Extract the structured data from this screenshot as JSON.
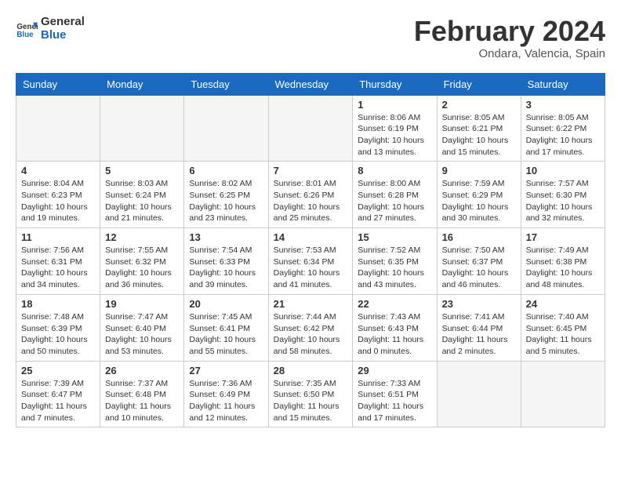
{
  "header": {
    "logo_line1": "General",
    "logo_line2": "Blue",
    "month_title": "February 2024",
    "subtitle": "Ondara, Valencia, Spain"
  },
  "weekdays": [
    "Sunday",
    "Monday",
    "Tuesday",
    "Wednesday",
    "Thursday",
    "Friday",
    "Saturday"
  ],
  "weeks": [
    [
      {
        "day": "",
        "info": ""
      },
      {
        "day": "",
        "info": ""
      },
      {
        "day": "",
        "info": ""
      },
      {
        "day": "",
        "info": ""
      },
      {
        "day": "1",
        "info": "Sunrise: 8:06 AM\nSunset: 6:19 PM\nDaylight: 10 hours\nand 13 minutes."
      },
      {
        "day": "2",
        "info": "Sunrise: 8:05 AM\nSunset: 6:21 PM\nDaylight: 10 hours\nand 15 minutes."
      },
      {
        "day": "3",
        "info": "Sunrise: 8:05 AM\nSunset: 6:22 PM\nDaylight: 10 hours\nand 17 minutes."
      }
    ],
    [
      {
        "day": "4",
        "info": "Sunrise: 8:04 AM\nSunset: 6:23 PM\nDaylight: 10 hours\nand 19 minutes."
      },
      {
        "day": "5",
        "info": "Sunrise: 8:03 AM\nSunset: 6:24 PM\nDaylight: 10 hours\nand 21 minutes."
      },
      {
        "day": "6",
        "info": "Sunrise: 8:02 AM\nSunset: 6:25 PM\nDaylight: 10 hours\nand 23 minutes."
      },
      {
        "day": "7",
        "info": "Sunrise: 8:01 AM\nSunset: 6:26 PM\nDaylight: 10 hours\nand 25 minutes."
      },
      {
        "day": "8",
        "info": "Sunrise: 8:00 AM\nSunset: 6:28 PM\nDaylight: 10 hours\nand 27 minutes."
      },
      {
        "day": "9",
        "info": "Sunrise: 7:59 AM\nSunset: 6:29 PM\nDaylight: 10 hours\nand 30 minutes."
      },
      {
        "day": "10",
        "info": "Sunrise: 7:57 AM\nSunset: 6:30 PM\nDaylight: 10 hours\nand 32 minutes."
      }
    ],
    [
      {
        "day": "11",
        "info": "Sunrise: 7:56 AM\nSunset: 6:31 PM\nDaylight: 10 hours\nand 34 minutes."
      },
      {
        "day": "12",
        "info": "Sunrise: 7:55 AM\nSunset: 6:32 PM\nDaylight: 10 hours\nand 36 minutes."
      },
      {
        "day": "13",
        "info": "Sunrise: 7:54 AM\nSunset: 6:33 PM\nDaylight: 10 hours\nand 39 minutes."
      },
      {
        "day": "14",
        "info": "Sunrise: 7:53 AM\nSunset: 6:34 PM\nDaylight: 10 hours\nand 41 minutes."
      },
      {
        "day": "15",
        "info": "Sunrise: 7:52 AM\nSunset: 6:35 PM\nDaylight: 10 hours\nand 43 minutes."
      },
      {
        "day": "16",
        "info": "Sunrise: 7:50 AM\nSunset: 6:37 PM\nDaylight: 10 hours\nand 46 minutes."
      },
      {
        "day": "17",
        "info": "Sunrise: 7:49 AM\nSunset: 6:38 PM\nDaylight: 10 hours\nand 48 minutes."
      }
    ],
    [
      {
        "day": "18",
        "info": "Sunrise: 7:48 AM\nSunset: 6:39 PM\nDaylight: 10 hours\nand 50 minutes."
      },
      {
        "day": "19",
        "info": "Sunrise: 7:47 AM\nSunset: 6:40 PM\nDaylight: 10 hours\nand 53 minutes."
      },
      {
        "day": "20",
        "info": "Sunrise: 7:45 AM\nSunset: 6:41 PM\nDaylight: 10 hours\nand 55 minutes."
      },
      {
        "day": "21",
        "info": "Sunrise: 7:44 AM\nSunset: 6:42 PM\nDaylight: 10 hours\nand 58 minutes."
      },
      {
        "day": "22",
        "info": "Sunrise: 7:43 AM\nSunset: 6:43 PM\nDaylight: 11 hours\nand 0 minutes."
      },
      {
        "day": "23",
        "info": "Sunrise: 7:41 AM\nSunset: 6:44 PM\nDaylight: 11 hours\nand 2 minutes."
      },
      {
        "day": "24",
        "info": "Sunrise: 7:40 AM\nSunset: 6:45 PM\nDaylight: 11 hours\nand 5 minutes."
      }
    ],
    [
      {
        "day": "25",
        "info": "Sunrise: 7:39 AM\nSunset: 6:47 PM\nDaylight: 11 hours\nand 7 minutes."
      },
      {
        "day": "26",
        "info": "Sunrise: 7:37 AM\nSunset: 6:48 PM\nDaylight: 11 hours\nand 10 minutes."
      },
      {
        "day": "27",
        "info": "Sunrise: 7:36 AM\nSunset: 6:49 PM\nDaylight: 11 hours\nand 12 minutes."
      },
      {
        "day": "28",
        "info": "Sunrise: 7:35 AM\nSunset: 6:50 PM\nDaylight: 11 hours\nand 15 minutes."
      },
      {
        "day": "29",
        "info": "Sunrise: 7:33 AM\nSunset: 6:51 PM\nDaylight: 11 hours\nand 17 minutes."
      },
      {
        "day": "",
        "info": ""
      },
      {
        "day": "",
        "info": ""
      }
    ]
  ]
}
